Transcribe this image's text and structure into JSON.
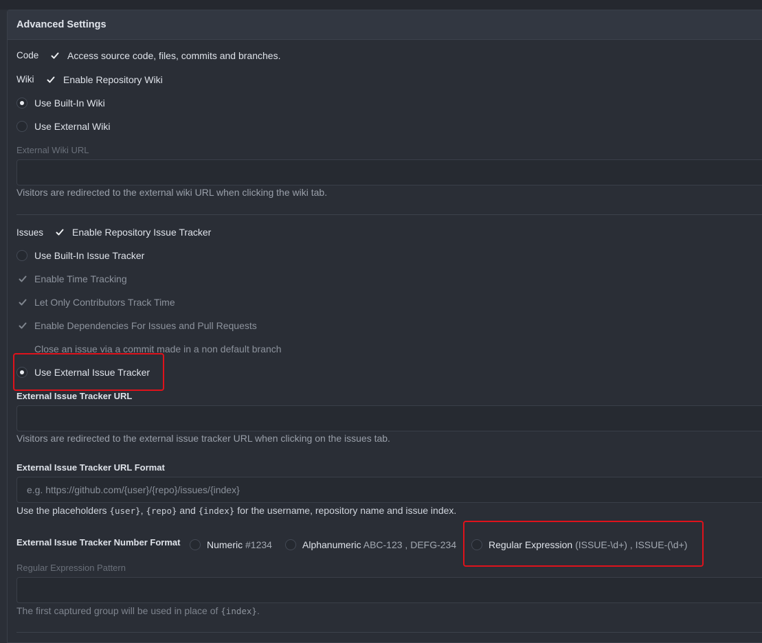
{
  "panel": {
    "title": "Advanced Settings"
  },
  "code": {
    "label": "Code",
    "option": "Access source code, files, commits and branches.",
    "checked": true
  },
  "wiki": {
    "label": "Wiki",
    "enable": "Enable Repository Wiki",
    "builtin": "Use Built-In Wiki",
    "external": "Use External Wiki",
    "url_label": "External Wiki URL",
    "url_value": "",
    "help": "Visitors are redirected to the external wiki URL when clicking the wiki tab."
  },
  "issues": {
    "label": "Issues",
    "enable": "Enable Repository Issue Tracker",
    "builtin": "Use Built-In Issue Tracker",
    "time_tracking": "Enable Time Tracking",
    "contributors_time": "Let Only Contributors Track Time",
    "dependencies": "Enable Dependencies For Issues and Pull Requests",
    "close_non_default": "Close an issue via a commit made in a non default branch",
    "external": "Use External Issue Tracker",
    "url_label": "External Issue Tracker URL",
    "url_value": "",
    "url_help": "Visitors are redirected to the external issue tracker URL when clicking on the issues tab.",
    "format_label": "External Issue Tracker URL Format",
    "format_placeholder": "e.g. https://github.com/{user}/{repo}/issues/{index}",
    "format_help_1": "Use the placeholders ",
    "ph_user": "{user}",
    "format_help_2": ", ",
    "ph_repo": "{repo}",
    "format_help_3": " and ",
    "ph_index": "{index}",
    "format_help_4": " for the username, repository name and issue index.",
    "number_format_label": "External Issue Tracker Number Format",
    "numeric": "Numeric",
    "numeric_example": "#1234",
    "alphanumeric": "Alphanumeric",
    "alphanumeric_example": "ABC-123 , DEFG-234",
    "regexp": "Regular Expression",
    "regexp_example": "(ISSUE-\\d+) , ISSUE-(\\d+)",
    "regexp_pattern_label": "Regular Expression Pattern",
    "regexp_pattern_value": "",
    "regexp_help_1": "The first captured group will be used in place of ",
    "regexp_help_index": "{index}",
    "regexp_help_2": "."
  },
  "colors": {
    "highlight": "#e0121b",
    "background": "#2b2f37"
  }
}
